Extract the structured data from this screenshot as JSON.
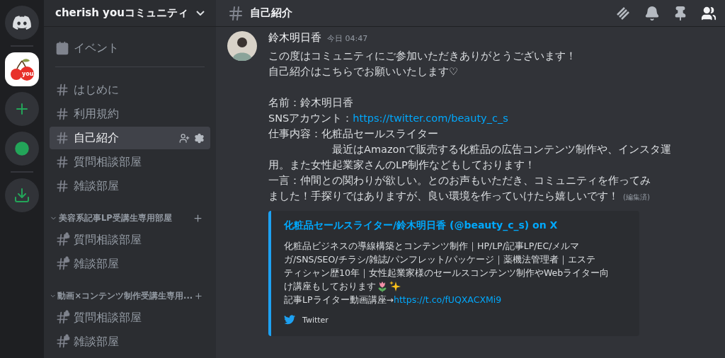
{
  "servers": [
    {
      "kind": "home",
      "selected": false
    },
    {
      "kind": "server",
      "selected": true,
      "logo_text": "you"
    },
    {
      "kind": "add",
      "selected": false
    },
    {
      "kind": "explore",
      "selected": false
    },
    {
      "kind": "download",
      "selected": false
    }
  ],
  "server_name": "cherish youコミュニティ",
  "event_item": {
    "label": "イベント"
  },
  "channels": [
    {
      "name": "はじめに",
      "selected": false,
      "locked": false
    },
    {
      "name": "利用規約",
      "selected": false,
      "locked": false
    },
    {
      "name": "自己紹介",
      "selected": true,
      "locked": false
    },
    {
      "name": "質問相談部屋",
      "selected": false,
      "locked": false
    },
    {
      "name": "雑談部屋",
      "selected": false,
      "locked": false
    }
  ],
  "categories": [
    {
      "name": "美容系記事LP受講生専用部屋",
      "expanded": true,
      "channels": [
        {
          "name": "質問相談部屋",
          "selected": false,
          "locked": true
        },
        {
          "name": "雑談部屋",
          "selected": false,
          "locked": true
        }
      ]
    },
    {
      "name": "動画×コンテンツ制作受講生専用...",
      "expanded": true,
      "channels": [
        {
          "name": "質問相談部屋",
          "selected": false,
          "locked": true
        },
        {
          "name": "雑談部屋",
          "selected": false,
          "locked": true
        }
      ]
    }
  ],
  "header": {
    "channel": "自己紹介"
  },
  "message": {
    "author": "鈴木明日香",
    "timestamp": "今日 04:47",
    "edited": "(編集済)",
    "paragraphs": [
      [
        {
          "text": "この度はコミュニティにご参加いただきありがとうございます！"
        },
        {
          "text": "自己紹介はこちらでお願いいたします♡"
        }
      ],
      [
        {
          "text": "名前：鈴木明日香"
        },
        {
          "text": "SNSアカウント：",
          "link": "https://twitter.com/beauty_c_s"
        },
        {
          "text": "仕事内容：化粧品セールスライター"
        },
        {
          "text": "　　　　　　最近はAmazonで販売する化粧品の広告コンテンツ制作や、インスタ運"
        },
        {
          "text": "用。また女性起業家さんのLP制作などもしております！"
        },
        {
          "text": "一言：仲間との関わりが欲しい。とのお声もいただき、コミュニティを作ってみ"
        },
        {
          "text": "ました！手探りではありますが、良い環境を作っていけたら嬉しいです！"
        }
      ]
    ]
  },
  "embed": {
    "title": "化粧品セールスライター/鈴木明日香 (@beauty_c_s) on X",
    "description": [
      "化粧品ビジネスの導線構築とコンテンツ制作｜HP/LP/記事LP/EC/メルマ",
      "ガ/SNS/SEO/チラシ/雑誌/パンフレット/パッケージ｜薬機法管理者｜エステ",
      "ティシャン歴10年｜女性起業家様のセールスコンテンツ制作やWebライター向",
      "け講座もしております"
    ],
    "link_prefix": "記事LPライター動画講座→",
    "link": "https://t.co/fUQXACXMi9",
    "provider": "Twitter"
  }
}
